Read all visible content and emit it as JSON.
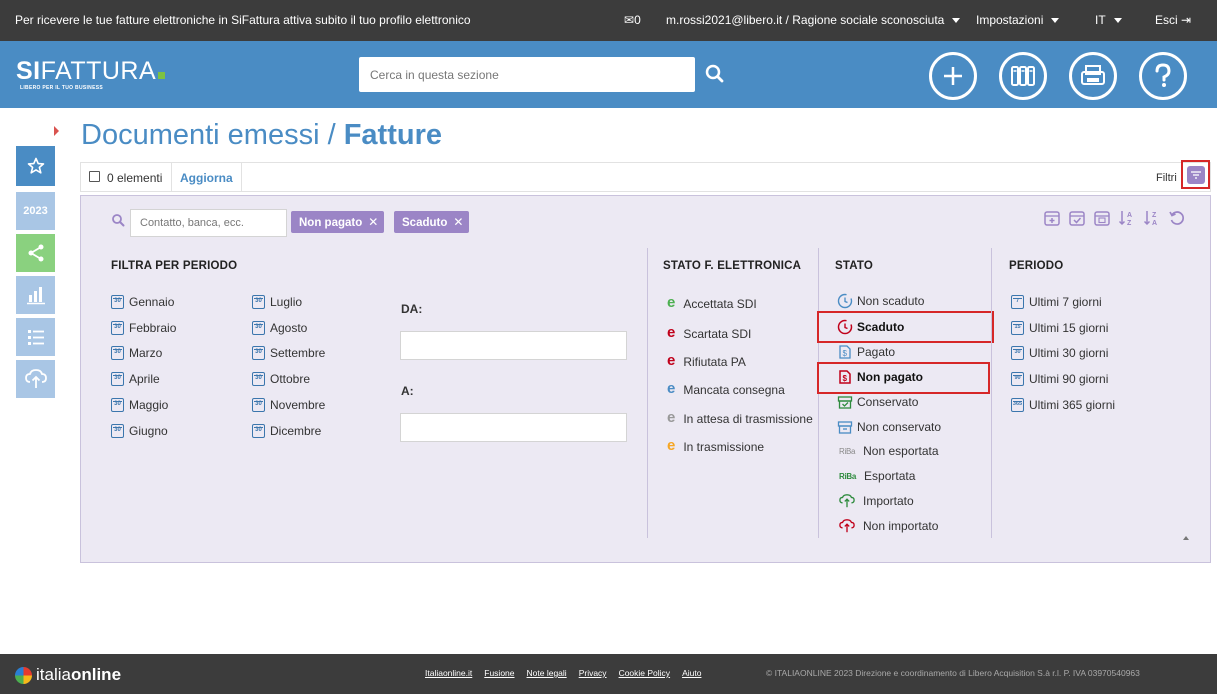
{
  "topbar": {
    "notice": "Per ricevere le tue fatture elettroniche in SiFattura attiva subito il tuo profilo elettronico",
    "mail_count": "0",
    "user": "m.rossi2021@libero.it / Ragione sociale sconosciuta",
    "settings": "Impostazioni",
    "language": "IT",
    "logout": "Esci"
  },
  "header": {
    "brand_bold": "SI",
    "brand_rest": "FATTURA",
    "tagline": "LIBERO PER IL TUO BUSINESS",
    "search_placeholder": "Cerca in questa sezione"
  },
  "sidebar": {
    "year": "2023"
  },
  "page": {
    "title_main": "Documenti emessi / ",
    "title_bold": "Fatture"
  },
  "toolbar": {
    "count": "0 elementi",
    "refresh": "Aggiorna",
    "filters": "Filtri"
  },
  "filters": {
    "search_placeholder": "Contatto, banca, ecc.",
    "chips": [
      "Non pagato",
      "Scaduto"
    ],
    "period_title": "FILTRA PER PERIODO",
    "months_col1": [
      "Gennaio",
      "Febbraio",
      "Marzo",
      "Aprile",
      "Maggio",
      "Giugno"
    ],
    "months_col2": [
      "Luglio",
      "Agosto",
      "Settembre",
      "Ottobre",
      "Novembre",
      "Dicembre"
    ],
    "from_label": "DA:",
    "to_label": "A:",
    "ef_title": "STATO F. ELETTRONICA",
    "ef_items": [
      {
        "label": "Accettata SDI",
        "color": "#4caf50"
      },
      {
        "label": "Scartata SDI",
        "color": "#c0001a"
      },
      {
        "label": "Rifiutata PA",
        "color": "#c0001a"
      },
      {
        "label": "Mancata consegna",
        "color": "#4a8cc4"
      },
      {
        "label": "In attesa di trasmissione",
        "color": "#999999"
      },
      {
        "label": "In trasmissione",
        "color": "#f6a623"
      }
    ],
    "state_title": "STATO",
    "state_items": [
      {
        "label": "Non scaduto",
        "icon": "clock-icon"
      },
      {
        "label": "Scaduto",
        "icon": "clock-expired-icon"
      },
      {
        "label": "Pagato",
        "icon": "paid-icon"
      },
      {
        "label": "Non pagato",
        "icon": "unpaid-icon"
      },
      {
        "label": "Conservato",
        "icon": "archive-icon"
      },
      {
        "label": "Non conservato",
        "icon": "archive-empty-icon"
      },
      {
        "label": "Non esportata",
        "icon": "riba-grey-icon"
      },
      {
        "label": "Esportata",
        "icon": "riba-green-icon"
      },
      {
        "label": "Importato",
        "icon": "cloud-upload-green-icon"
      },
      {
        "label": "Non importato",
        "icon": "cloud-upload-red-icon"
      }
    ],
    "riba_label": "RiBa",
    "period_col_title": "PERIODO",
    "period_items": [
      {
        "label": "Ultimi 7 giorni",
        "num": "7"
      },
      {
        "label": "Ultimi 15 giorni",
        "num": "15"
      },
      {
        "label": "Ultimi 30 giorni",
        "num": "30"
      },
      {
        "label": "Ultimi 90 giorni",
        "num": "90"
      },
      {
        "label": "Ultimi 365 giorni",
        "num": "365"
      }
    ],
    "calendar_num": "30"
  },
  "footer": {
    "logo_light": "italia",
    "logo_bold": "online",
    "links": [
      "Italiaonline.it",
      "Fusione",
      "Note legali",
      "Privacy",
      "Cookie Policy",
      "Aiuto"
    ],
    "copyright": "© ITALIAONLINE 2023   Direzione e coordinamento di Libero Acquisition S.à r.l.   P. IVA 03970540963"
  }
}
